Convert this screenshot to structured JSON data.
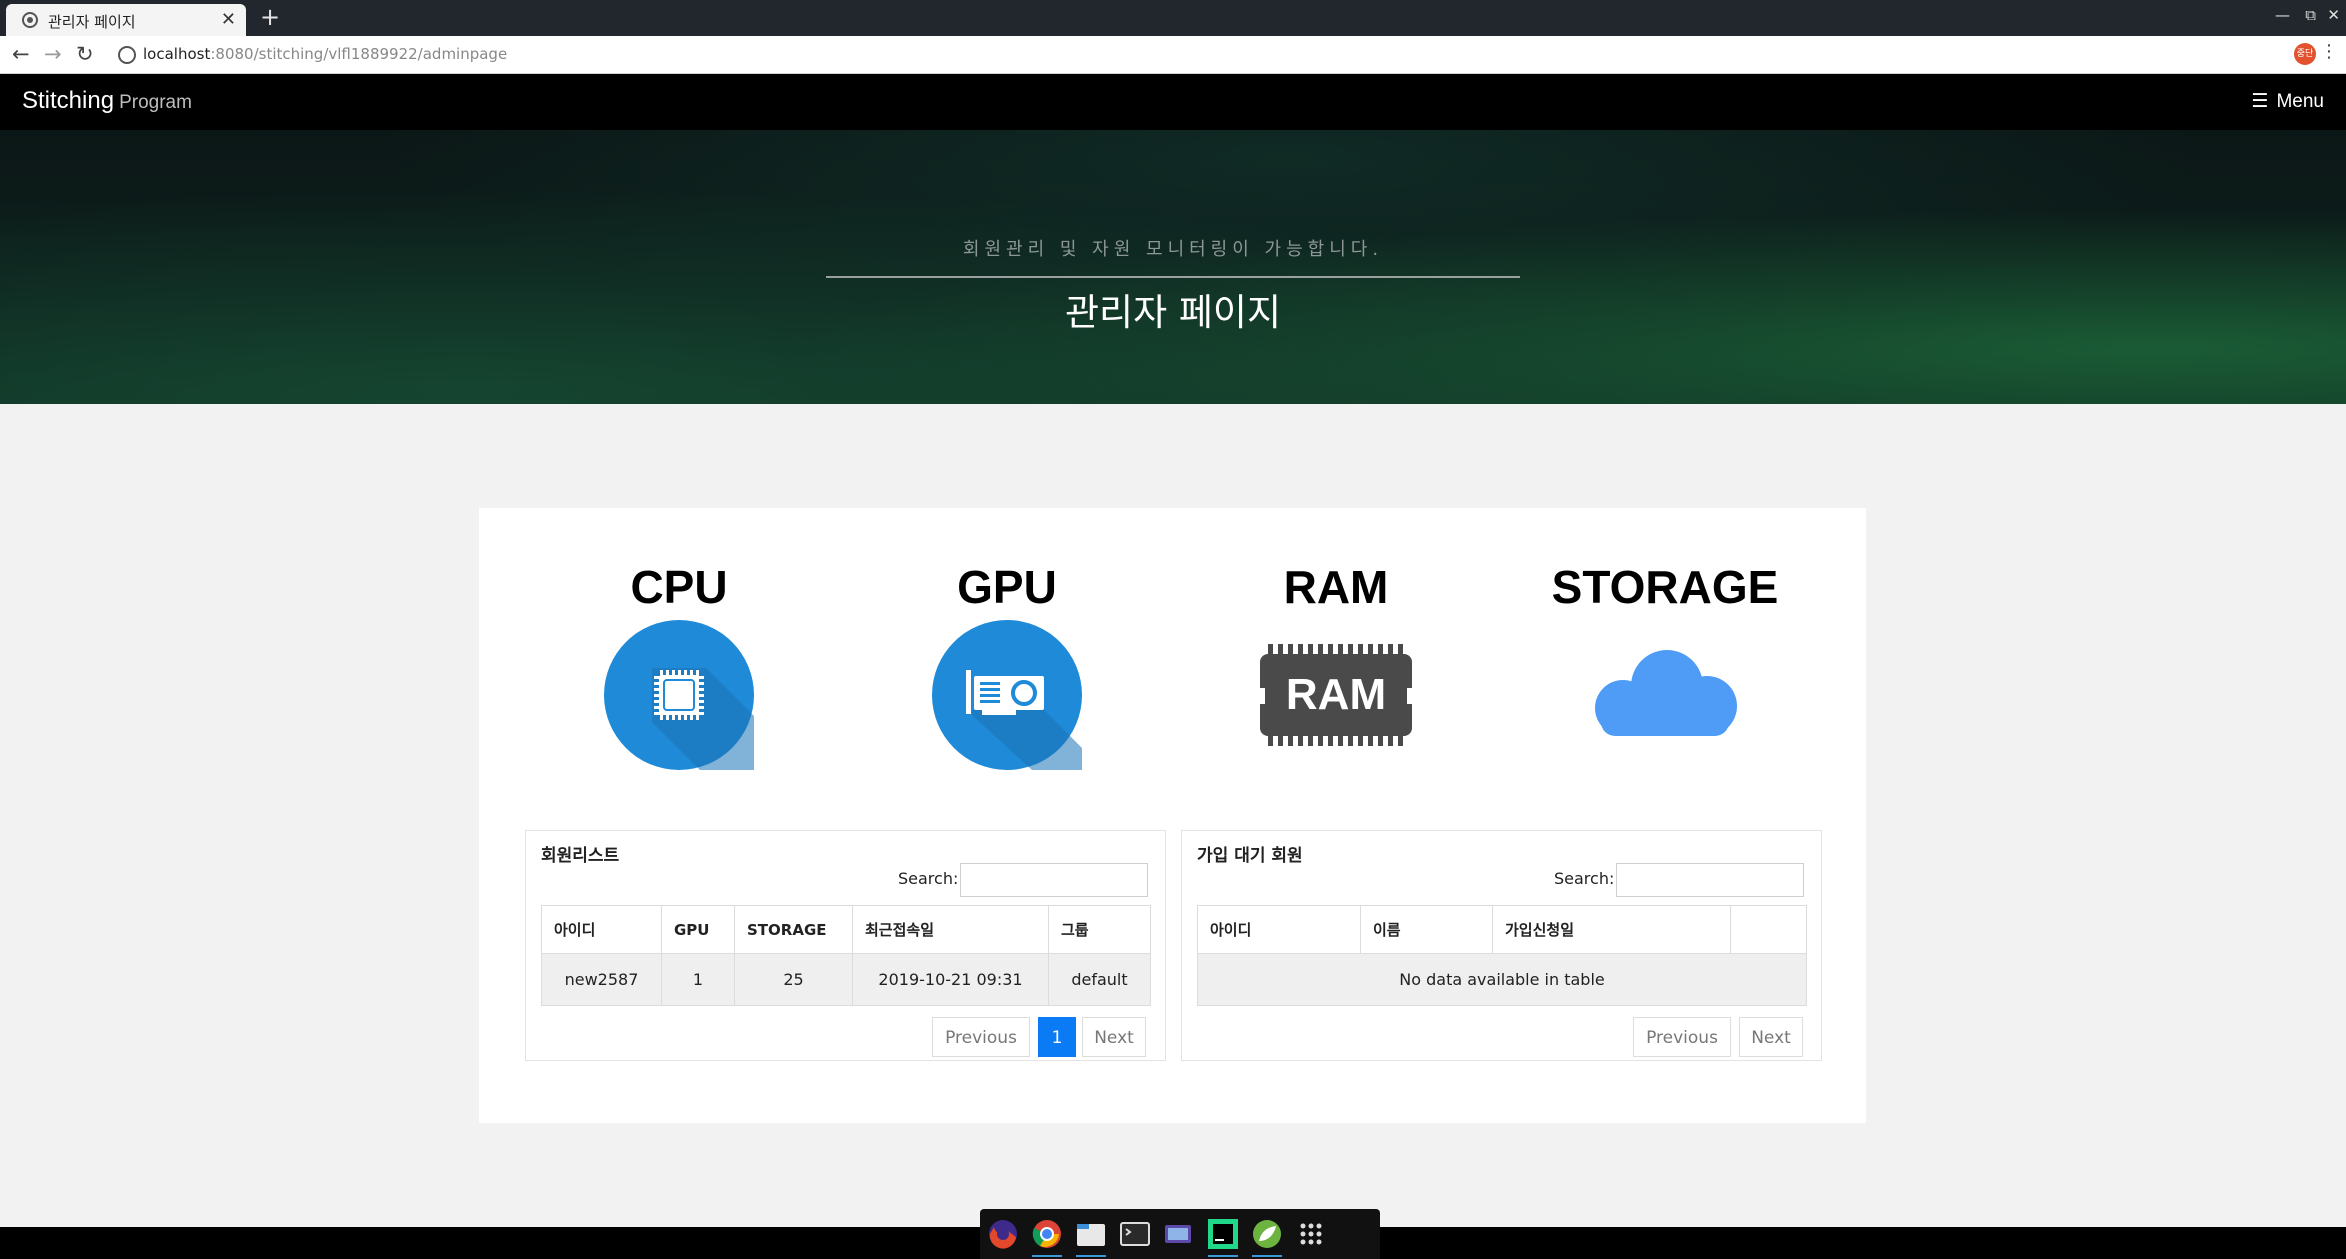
{
  "browser": {
    "tab_title": "관리자 페이지",
    "tab_close": "✕",
    "new_tab": "+",
    "url_host": "localhost",
    "url_rest": ":8080/stitching/vlfl1889922/adminpage",
    "profile_label": "중단"
  },
  "navbar": {
    "brand_main": "Stitching",
    "brand_sub": "Program",
    "menu_label": "Menu"
  },
  "hero": {
    "subtitle": "회원관리 및 자원 모니터링이 가능합니다.",
    "title": "관리자 페이지"
  },
  "resources": [
    {
      "label": "CPU",
      "icon": "cpu-chip-icon"
    },
    {
      "label": "GPU",
      "icon": "graphics-card-icon"
    },
    {
      "label": "RAM",
      "icon": "ram-module-icon",
      "chip_text": "RAM"
    },
    {
      "label": "STORAGE",
      "icon": "cloud-icon"
    }
  ],
  "members": {
    "title": "회원리스트",
    "search_label": "Search:",
    "search_value": "",
    "columns": [
      "아이디",
      "GPU",
      "STORAGE",
      "최근접속일",
      "그룹"
    ],
    "rows": [
      [
        "new2587",
        "1",
        "25",
        "2019-10-21 09:31",
        "default"
      ]
    ],
    "pager": {
      "previous": "Previous",
      "page": "1",
      "next": "Next"
    }
  },
  "pending": {
    "title": "가입 대기 회원",
    "search_label": "Search:",
    "search_value": "",
    "columns": [
      "아이디",
      "이름",
      "가입신청일",
      ""
    ],
    "empty_message": "No data available in table",
    "pager": {
      "previous": "Previous",
      "next": "Next"
    }
  },
  "taskbar": [
    "firefox-icon",
    "chrome-icon",
    "files-icon",
    "terminal-icon",
    "screenshot-icon",
    "pycharm-icon",
    "spring-icon",
    "app-grid-icon"
  ],
  "colors": {
    "accent": "#0a7bf5",
    "icon_blue": "#1f8ad8",
    "cloud_blue": "#4e9cf5",
    "ram_gray": "#4a4a4a"
  }
}
